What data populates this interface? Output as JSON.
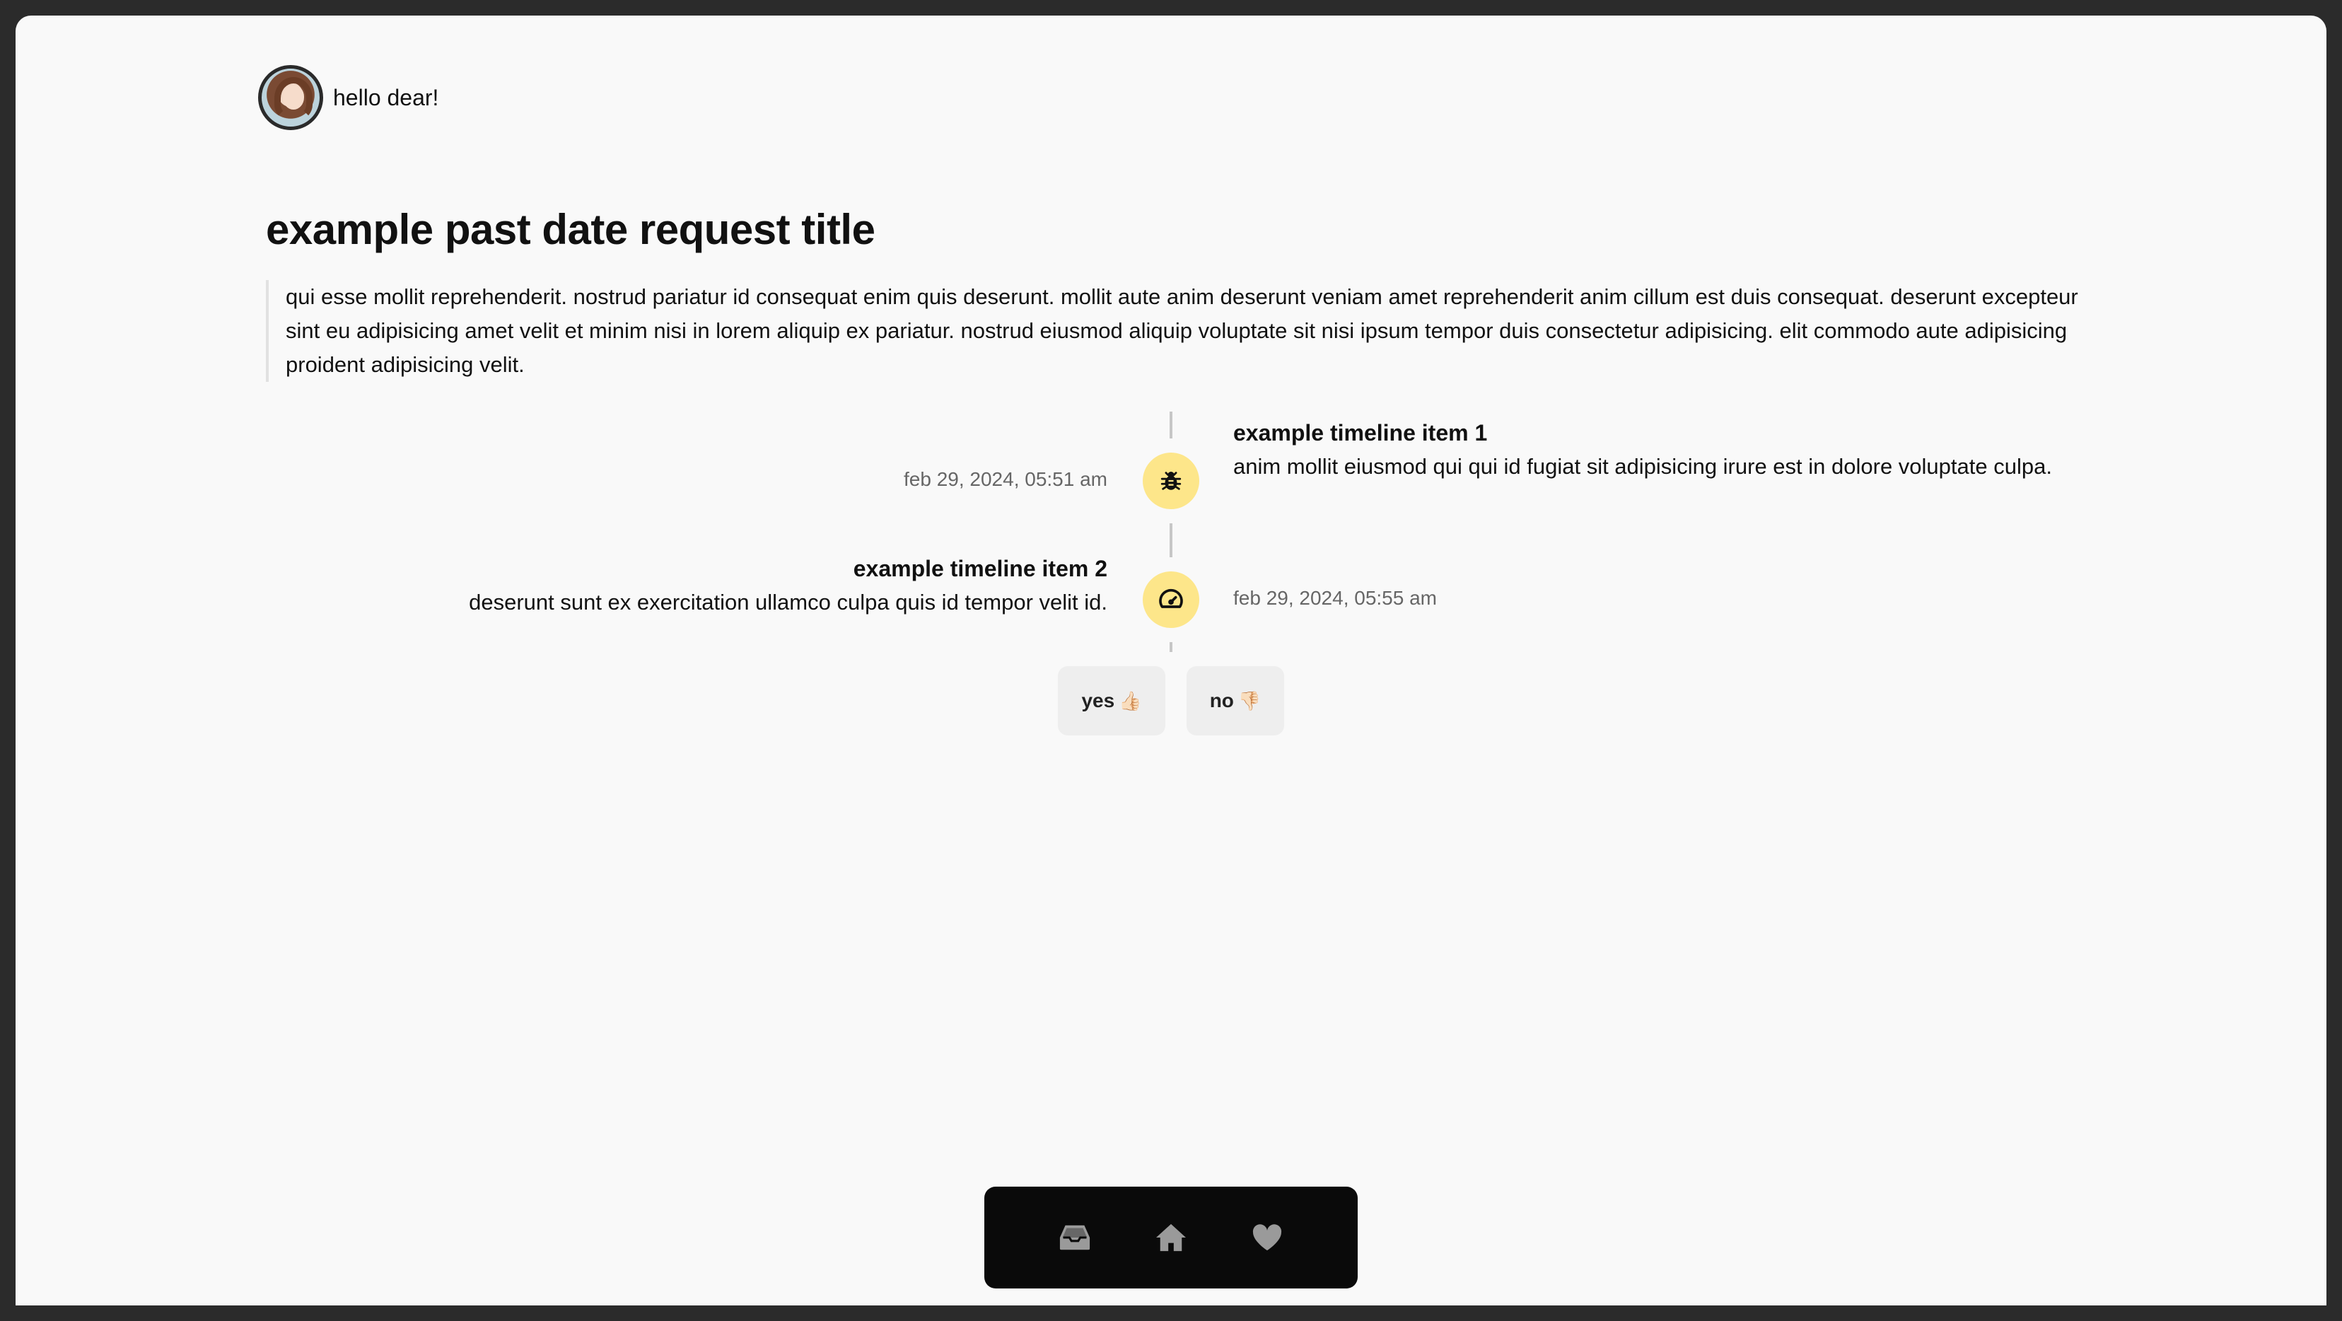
{
  "header": {
    "avatar_icon": "girl-avatar",
    "greeting": "hello dear!"
  },
  "request": {
    "title": "example past date request title",
    "description": "qui esse mollit reprehenderit. nostrud pariatur id consequat enim quis deserunt. mollit aute anim deserunt veniam amet reprehenderit anim cillum est duis consequat. deserunt excepteur sint eu adipisicing amet velit et minim nisi in lorem aliquip ex pariatur. nostrud eiusmod aliquip voluptate sit nisi ipsum tempor duis consectetur adipisicing. elit commodo aute adipisicing proident adipisicing velit."
  },
  "timeline": {
    "items": [
      {
        "title": "example timeline item 1",
        "description": "anim mollit eiusmod qui qui id fugiat sit adipisicing irure est in dolore voluptate culpa.",
        "date": "feb 29, 2024, 05:51 am",
        "icon": "bug-icon"
      },
      {
        "title": "example timeline item 2",
        "description": "deserunt sunt ex exercitation ullamco culpa quis id tempor velit id.",
        "date": "feb 29, 2024, 05:55 am",
        "icon": "gauge-icon"
      }
    ],
    "icon_bg_color": "#fde68a"
  },
  "actions": {
    "yes_label": "yes",
    "yes_emoji": "👍🏻",
    "no_label": "no",
    "no_emoji": "👎🏻"
  },
  "dock": {
    "items": [
      "inbox-icon",
      "home-icon",
      "heart-icon"
    ]
  }
}
